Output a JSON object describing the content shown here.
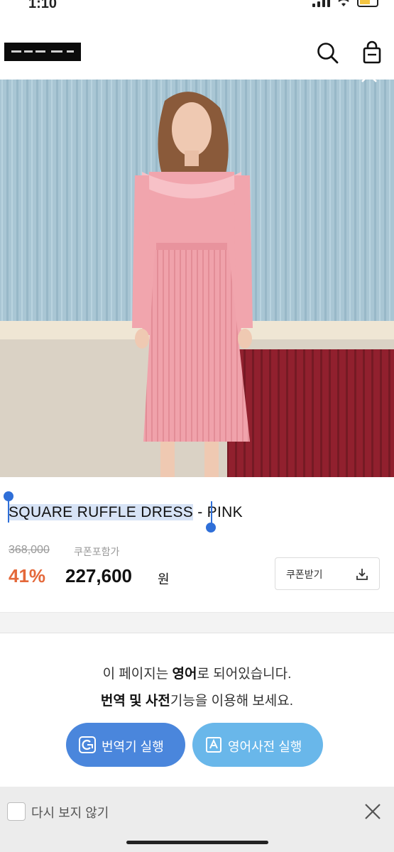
{
  "status_bar": {
    "time": "1:10"
  },
  "header": {
    "logo": "brand-logo",
    "search_icon": "search-icon",
    "bag_icon": "shopping-bag-icon"
  },
  "product": {
    "title_selected": "SQUARE RUFFLE DRESS",
    "title_rest": " - PINK",
    "original_price": "368,000",
    "coupon_note": "쿠폰포함가",
    "discount": "41%",
    "price": "227,600",
    "currency": "원",
    "coupon_button": "쿠폰받기",
    "colors": {
      "discount": "#e4683a",
      "dress": "#f1a5ad"
    }
  },
  "translate_banner": {
    "line1_pre": "이 페이지는 ",
    "line1_bold": "영어",
    "line1_post": "로 되어있습니다.",
    "line2_bold": "번역 및 사전",
    "line2_post": "기능을 이용해 보세요.",
    "translator_button": "번역기 실행",
    "dictionary_button": "영어사전 실행",
    "colors": {
      "translator": "#4a86dc",
      "dictionary": "#69b7ea"
    }
  },
  "bottom_bar": {
    "dont_show_label": "다시 보지 않기"
  }
}
